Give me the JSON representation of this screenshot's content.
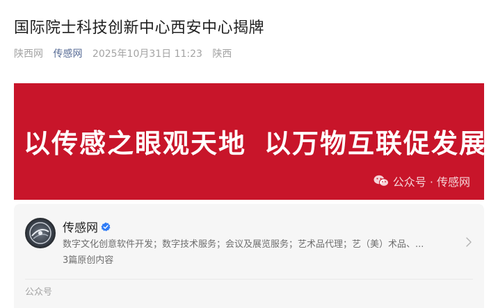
{
  "article": {
    "title": "国际院士科技创新中心西安中心揭牌",
    "source": "陕西网",
    "author": "传感网",
    "datetime": "2025年10月31日 11:23",
    "location": "陕西"
  },
  "banner": {
    "line_left": "以传感之眼观天地",
    "line_right": "以万物互联促发展",
    "watermark": "公众号 · 传感网",
    "background_color": "#c8152a"
  },
  "account_card": {
    "name": "传感网",
    "description": "数字文化创意软件开发；数字技术服务；会议及展览服务；艺术品代理；艺（美）术品、...",
    "original_count": "3篇原创内容",
    "footer_label": "公众号",
    "verified_color": "#2f7cf6"
  }
}
